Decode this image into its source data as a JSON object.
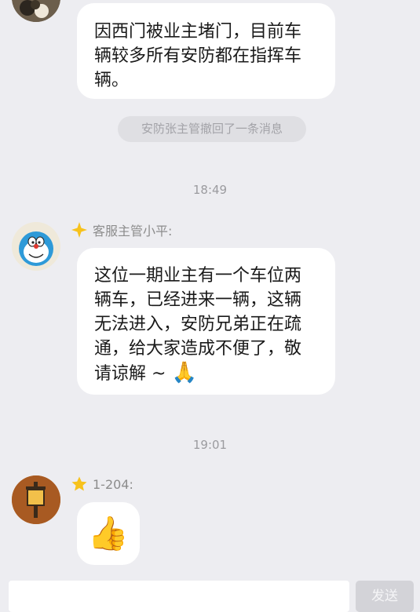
{
  "messages": [
    {
      "type": "text",
      "text": "因西门被业主堵门，目前车辆较多所有安防都在指挥车辆。"
    },
    {
      "type": "recall",
      "text": "安防张主管撤回了一条消息"
    },
    {
      "type": "time",
      "text": "18:49"
    },
    {
      "type": "text",
      "sender": "客服主管小平:",
      "badge_icon": "star-badge-icon",
      "text": "这位一期业主有一个车位两辆车，已经进来一辆，这辆无法进入，安防兄弟正在疏通，给大家造成不便了，敬请谅解 ~",
      "emoji": "🙏",
      "emoji_name": "pray-emoji"
    },
    {
      "type": "time",
      "text": "19:01"
    },
    {
      "type": "sticker",
      "sender": "1-204:",
      "badge_icon": "star-badge-icon",
      "sticker": "👍",
      "sticker_name": "thumbs-up-emoji"
    }
  ],
  "input": {
    "placeholder": "",
    "send_label": "发送"
  },
  "colors": {
    "background": "#ededf1",
    "bubble": "#ffffff",
    "badge_star": "#f7c21c",
    "send_button": "#d3d3d8"
  }
}
